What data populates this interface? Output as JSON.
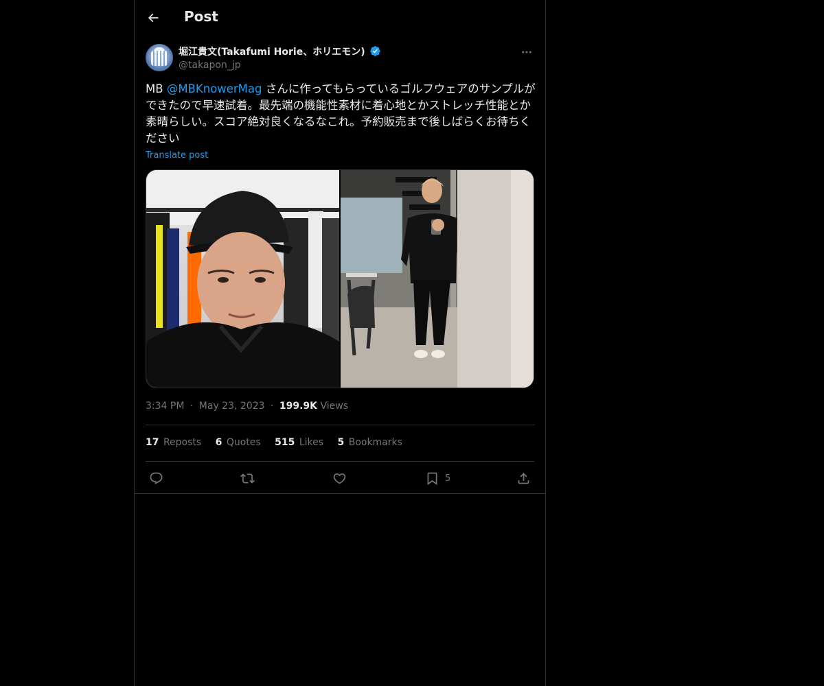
{
  "header": {
    "title": "Post"
  },
  "author": {
    "display_name": "堀江貴文(Takafumi Horie、ホリエモン)",
    "handle": "@takapon_jp"
  },
  "tweet": {
    "text_before": "MB ",
    "mention": "@MBKnowerMag",
    "text_after": " さんに作ってもらっているゴルフウェアのサンプルができたので早速試着。最先端の機能性素材に着心地とかストレッチ性能とか素晴らしい。スコア絶対良くなるなこれ。予約販売まで後しばらくお待ちください",
    "translate_label": "Translate post"
  },
  "meta": {
    "time": "3:34 PM",
    "separator": "·",
    "date": "May 23, 2023",
    "views_count": "199.9K",
    "views_label": "Views"
  },
  "stats": {
    "reposts_count": "17",
    "reposts_label": "Reposts",
    "quotes_count": "6",
    "quotes_label": "Quotes",
    "likes_count": "515",
    "likes_label": "Likes",
    "bookmarks_count": "5",
    "bookmarks_label": "Bookmarks"
  },
  "actions": {
    "bookmark_count": "5"
  },
  "colors": {
    "accent": "#1d9bf0",
    "background": "#000000",
    "text": "#e7e9ea",
    "muted": "#71767b",
    "border": "#2f3336"
  },
  "icons": [
    "back-arrow-icon",
    "verified-badge-icon",
    "more-icon",
    "reply-icon",
    "repost-icon",
    "like-icon",
    "bookmark-icon",
    "share-icon"
  ]
}
